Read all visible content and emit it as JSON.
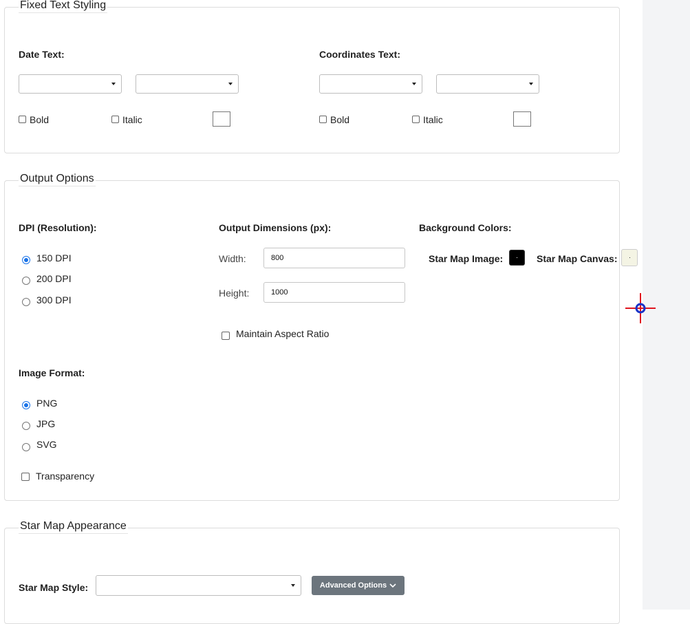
{
  "fixed_text_styling": {
    "legend": "Fixed Text Styling",
    "date": {
      "label": "Date Text:",
      "bold": "Bold",
      "italic": "Italic"
    },
    "coords": {
      "label": "Coordinates Text:",
      "bold": "Bold",
      "italic": "Italic"
    }
  },
  "output_options": {
    "legend": "Output Options",
    "dpi": {
      "label": "DPI (Resolution):",
      "options": [
        "150 DPI",
        "200 DPI",
        "300 DPI"
      ],
      "selected": "150 DPI"
    },
    "dimensions": {
      "label": "Output Dimensions (px):",
      "width_label": "Width:",
      "width_value": "800",
      "height_label": "Height:",
      "height_value": "1000",
      "aspect_label": "Maintain Aspect Ratio"
    },
    "background": {
      "label": "Background Colors:",
      "image_label": "Star Map Image:",
      "image_color": "#000000",
      "canvas_label": "Star Map Canvas:",
      "canvas_color": "#f4f4e4"
    },
    "format": {
      "label": "Image Format:",
      "options": [
        "PNG",
        "JPG",
        "SVG"
      ],
      "selected": "PNG",
      "transparency_label": "Transparency"
    }
  },
  "appearance": {
    "legend": "Star Map Appearance",
    "style_label": "Star Map Style:",
    "advanced_label": "Advanced Options"
  }
}
